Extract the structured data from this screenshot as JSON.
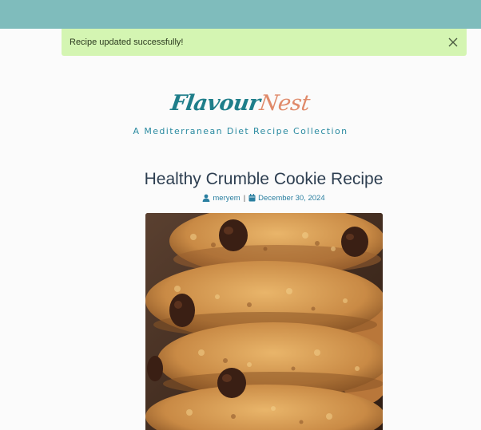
{
  "alert": {
    "message": "Recipe updated successfully!",
    "close_icon": "close-icon"
  },
  "brand": {
    "logo_part1": "Flavour",
    "logo_part2": "Nest",
    "tagline": "A Mediterranean Diet Recipe Collection"
  },
  "post": {
    "title": "Healthy Crumble Cookie Recipe",
    "author": "meryem",
    "separator": "|",
    "date": "December 30, 2024",
    "author_icon": "user-icon",
    "date_icon": "calendar-icon"
  },
  "colors": {
    "topbar": "#7fbcbc",
    "alert_bg": "#d4f5b2",
    "logo_primary": "#1f7e8a",
    "logo_accent": "#e08a6a",
    "title": "#2d3e50",
    "meta": "#2a7fa0"
  }
}
